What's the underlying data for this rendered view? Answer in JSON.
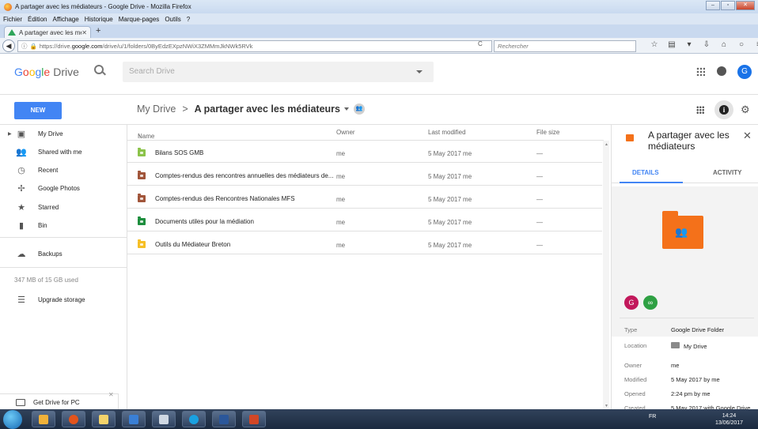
{
  "browser": {
    "window_title": "A partager avec les médiateurs - Google Drive - Mozilla Firefox",
    "menu": [
      "Fichier",
      "Édition",
      "Affichage",
      "Historique",
      "Marque-pages",
      "Outils",
      "?"
    ],
    "tab_title": "A partager avec les médiat...",
    "url_prefix": "https://drive.",
    "url_host": "google.com",
    "url_path": "/drive/u/1/folders/0ByEdzEXpzNWiX3ZMMmJkNWk5RVk",
    "search_placeholder": "Rechercher"
  },
  "header": {
    "logo_google": [
      "G",
      "o",
      "o",
      "g",
      "l",
      "e"
    ],
    "logo_product": "Drive",
    "search_placeholder": "Search Drive",
    "avatar_letter": "G"
  },
  "toolbar": {
    "new_label": "NEW",
    "breadcrumb_root": "My Drive",
    "breadcrumb_sep": ">",
    "breadcrumb_current": "A partager avec les médiateurs"
  },
  "sidebar": {
    "items": [
      {
        "label": "My Drive",
        "icon": "drive-icon"
      },
      {
        "label": "Shared with me",
        "icon": "people-icon"
      },
      {
        "label": "Recent",
        "icon": "clock-icon"
      },
      {
        "label": "Google Photos",
        "icon": "pinwheel-icon"
      },
      {
        "label": "Starred",
        "icon": "star-icon"
      },
      {
        "label": "Bin",
        "icon": "trash-icon"
      },
      {
        "label": "Backups",
        "icon": "cloud-icon"
      }
    ],
    "storage": "347 MB of 15 GB used",
    "upgrade": "Upgrade storage",
    "get_drive": "Get Drive for PC"
  },
  "list": {
    "headers": {
      "name": "Name",
      "owner": "Owner",
      "modified": "Last modified",
      "size": "File size"
    },
    "rows": [
      {
        "name": "Bilans SOS GMB",
        "owner": "me",
        "modified": "5 May 2017 me",
        "size": "—",
        "color": "#8bc34a"
      },
      {
        "name": "Comptes-rendus des rencontres annuelles des médiateurs de...",
        "owner": "me",
        "modified": "5 May 2017 me",
        "size": "—",
        "color": "#a1553a"
      },
      {
        "name": "Comptes-rendus des Rencontres Nationales MFS",
        "owner": "me",
        "modified": "5 May 2017 me",
        "size": "—",
        "color": "#a1553a"
      },
      {
        "name": "Documents utiles pour la médiation",
        "owner": "me",
        "modified": "5 May 2017 me",
        "size": "—",
        "color": "#1e8e3e"
      },
      {
        "name": "Outils du Médiateur Breton",
        "owner": "me",
        "modified": "5 May 2017 me",
        "size": "—",
        "color": "#f6bf26"
      }
    ]
  },
  "details": {
    "title": "A partager avec les médiateurs",
    "tab_details": "DETAILS",
    "tab_activity": "ACTIVITY",
    "access": [
      {
        "letter": "G",
        "color": "#c2185b"
      },
      {
        "letter": "∞",
        "color": "#2ea043"
      }
    ],
    "props": [
      {
        "label": "Type",
        "value": "Google Drive Folder"
      },
      {
        "label": "Location",
        "value": "My Drive"
      },
      {
        "label": "Owner",
        "value": "me"
      },
      {
        "label": "Modified",
        "value": "5 May 2017 by me"
      },
      {
        "label": "Opened",
        "value": "2:24 pm by me"
      },
      {
        "label": "Created",
        "value": "5 May 2017 with Google Drive"
      }
    ]
  },
  "taskbar": {
    "lang": "FR",
    "time": "14:24",
    "date": "13/06/2017"
  }
}
